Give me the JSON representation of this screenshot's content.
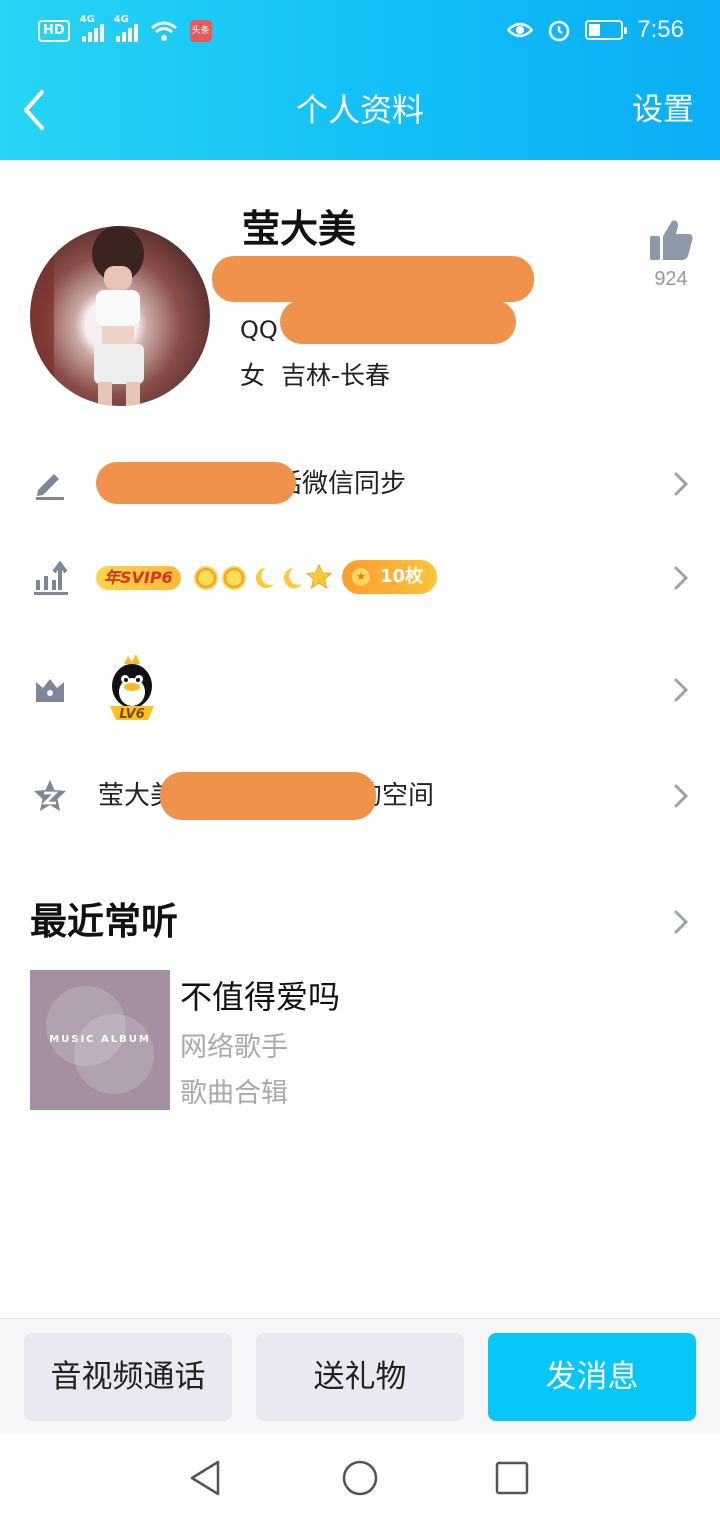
{
  "status_bar": {
    "hd": "HD",
    "net1": "4G",
    "net2": "4G",
    "app_badge": "头条",
    "time": "7:56",
    "battery_level": 0.35
  },
  "nav": {
    "title": "个人资料",
    "settings": "设置"
  },
  "profile": {
    "name": "莹大美",
    "qq_prefix": "QQ",
    "gender": "女",
    "location": "吉林-长春",
    "like_count": "924"
  },
  "rows": {
    "sync_suffix": "话微信同步",
    "svip_label": "年SVIP6",
    "coins_label": "10枚",
    "level_label": "LV6",
    "space_prefix": "莹大美",
    "space_suffix": "的空间"
  },
  "recent": {
    "title": "最近常听",
    "song_title": "不值得爱吗",
    "artist": "网络歌手",
    "album": "歌曲合辑",
    "album_art_text": "MUSIC ALBUM"
  },
  "actions": {
    "call": "音视频通话",
    "gift": "送礼物",
    "message": "发消息"
  },
  "colors": {
    "header_start": "#27d5f4",
    "header_end": "#0aaef4",
    "accent_button": "#07c7f8",
    "redaction": "#f0914c"
  }
}
